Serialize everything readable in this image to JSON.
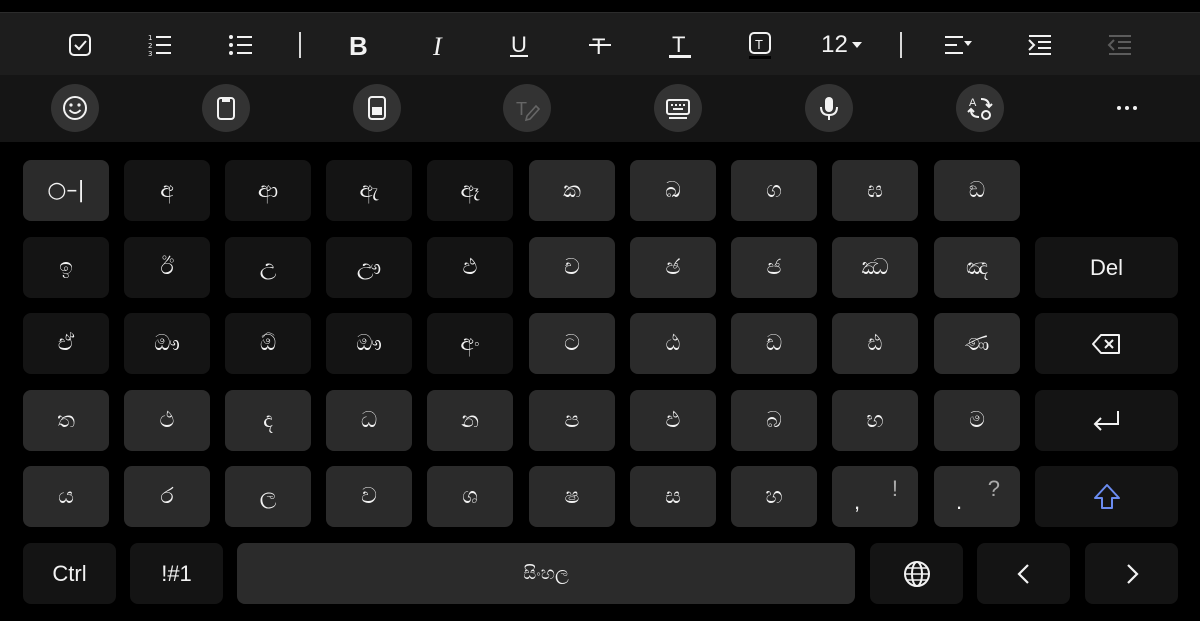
{
  "format_toolbar": {
    "font_size": "12",
    "icons": [
      "checkbox-icon",
      "numbered-list-icon",
      "bullet-list-icon",
      "bold-icon",
      "italic-icon",
      "underline-icon",
      "strikethrough-icon",
      "text-color-icon",
      "highlight-color-icon",
      "align-icon",
      "indent-icon",
      "outdent-icon"
    ]
  },
  "tool_row": {
    "icons": [
      "emoji-icon",
      "clipboard-icon",
      "one-handed-icon",
      "handwriting-icon",
      "keyboard-settings-icon",
      "microphone-icon",
      "translate-icon",
      "more-icon"
    ]
  },
  "keyboard": {
    "row1": [
      "○–|",
      "අ",
      "ආ",
      "ඇ",
      "ඈ",
      "ක",
      "ඛ",
      "ග",
      "ඝ",
      "ඞ"
    ],
    "row2": [
      "ඉ",
      "ඊ",
      "උ",
      "ඌ",
      "ඵ",
      "ච",
      "ඡ",
      "ජ",
      "ඣ",
      "ඤ"
    ],
    "row2_del": "Del",
    "row3": [
      "ඒ",
      "ඖ",
      "ඕ",
      "ඖ",
      "අං",
      "ට",
      "ඨ",
      "ඩ",
      "ඪ",
      "ණ"
    ],
    "row4": [
      "ත",
      "ථ",
      "ද",
      "ධ",
      "න",
      "ප",
      "ඵ",
      "බ",
      "භ",
      "ම"
    ],
    "row5": [
      "ය",
      "ර",
      "ල",
      "ව",
      "ශ",
      "ෂ",
      "ස",
      "හ"
    ],
    "row5_punct": [
      {
        "main": ",",
        "alt": "!"
      },
      {
        "main": ".",
        "alt": "?"
      }
    ],
    "ctrl": "Ctrl",
    "symbols": "!#1",
    "space": "සිංහල"
  }
}
